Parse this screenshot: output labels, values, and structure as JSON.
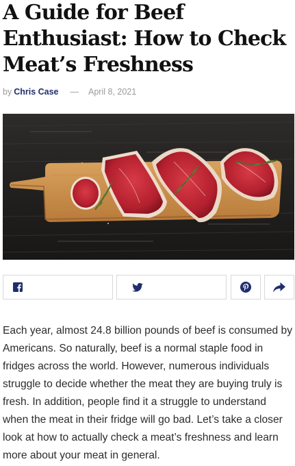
{
  "article": {
    "title": "A Guide for Beef Enthusiast: How to Check Meat’s Freshness",
    "byline_prefix": "by",
    "author": "Chris Case",
    "separator": "—",
    "date": "April 8, 2021",
    "hero_image": "raw beef steaks on a wooden cutting board with rosemary",
    "body": "Each year, almost 24.8 billion pounds of beef is consumed by Americans. So naturally, beef is a normal staple food in fridges across the world. However, numerous individuals struggle to decide whether the meat they are buying truly is fresh. In addition, people find it a struggle to understand when the meat in their fridge will go bad. Let’s take a closer look at how to actually check a meat’s freshness and learn more about your meat in general."
  },
  "share": {
    "buttons": [
      {
        "icon": "facebook-icon"
      },
      {
        "icon": "twitter-icon"
      },
      {
        "icon": "pinterest-icon"
      },
      {
        "icon": "share-arrow-icon"
      }
    ]
  },
  "colors": {
    "author": "#1e2e6e",
    "icon": "#1e2e6e",
    "meta": "#9a9a9a",
    "text": "#2b2b2b",
    "border": "#d8d8d8"
  }
}
